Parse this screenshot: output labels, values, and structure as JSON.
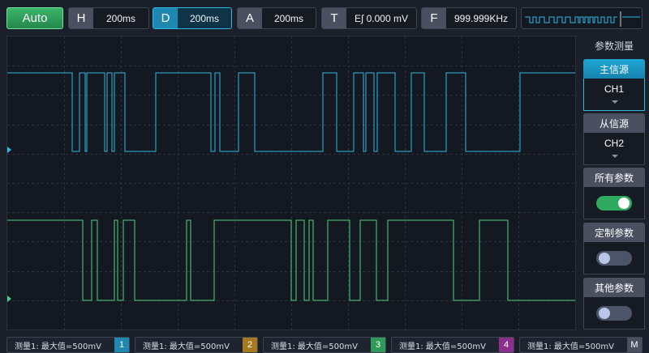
{
  "toolbar": {
    "auto_label": "Auto",
    "horizontal": {
      "key": "H",
      "value": "200ms"
    },
    "delay": {
      "key": "D",
      "value": "200ms"
    },
    "amplitude": {
      "key": "A",
      "value": "200ms"
    },
    "trigger": {
      "key": "T",
      "value": "E∫ 0.000 mV"
    },
    "frequency": {
      "key": "F",
      "value": "999.999KHz"
    }
  },
  "colors": {
    "ch1": "#2fb9e2",
    "ch2": "#4fcf7c",
    "accent": "#1fa6d6",
    "grid": "#2c3340"
  },
  "panel": {
    "title": "参数测量",
    "main_source": {
      "label": "主信源",
      "value": "CH1"
    },
    "sub_source": {
      "label": "从信源",
      "value": "CH2"
    },
    "all_params": {
      "label": "所有参数",
      "toggle": "on"
    },
    "custom_params": {
      "label": "定制参数",
      "toggle": "off"
    },
    "other_params": {
      "label": "其他参数",
      "toggle": "off"
    }
  },
  "measurements": [
    {
      "text": "测量1: 最大值=500mV",
      "badge": "1",
      "color": "#1f88b2"
    },
    {
      "text": "测量1: 最大值=500mV",
      "badge": "2",
      "color": "#a57a1f"
    },
    {
      "text": "测量1: 最大值=500mV",
      "badge": "3",
      "color": "#2f9a5a"
    },
    {
      "text": "测量1: 最大值=500mV",
      "badge": "4",
      "color": "#8b2f8c"
    },
    {
      "text": "测量1: 最大值=500mV",
      "badge": "M",
      "color": "#4a5060"
    }
  ]
}
